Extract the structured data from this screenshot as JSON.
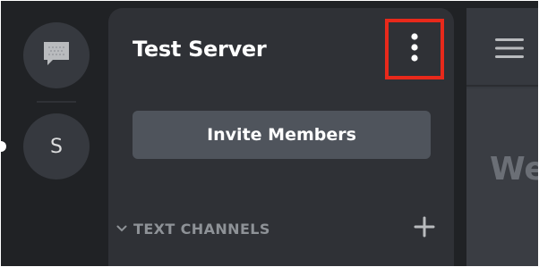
{
  "rail": {
    "server_initial": "S"
  },
  "panel": {
    "server_name": "Test Server",
    "invite_label": "Invite Members",
    "category_label": "TEXT CHANNELS"
  },
  "chat": {
    "welcome_fragment": "We"
  },
  "icons": {
    "dm": "chat-bubble-icon",
    "more": "vertical-ellipsis-icon",
    "chevron": "chevron-down-icon",
    "add": "plus-icon",
    "menu": "hamburger-icon"
  },
  "colors": {
    "background": "#202225",
    "panel": "#2f3136",
    "button": "#4f545c",
    "highlight": "#e8291b",
    "text_muted": "#8e9297"
  }
}
